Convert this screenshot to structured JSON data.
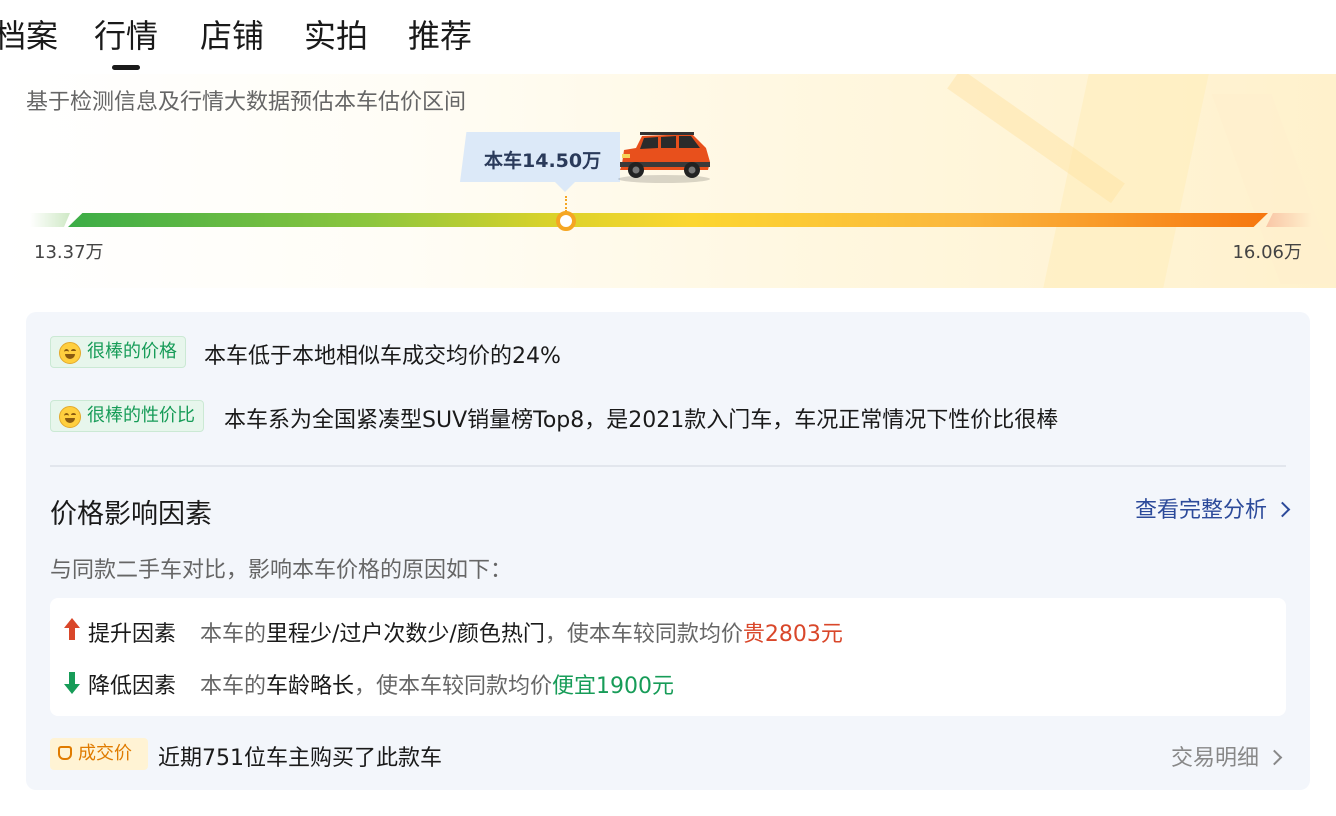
{
  "tabs": [
    {
      "label": "档案"
    },
    {
      "label": "行情",
      "active": true
    },
    {
      "label": "店铺"
    },
    {
      "label": "实拍"
    },
    {
      "label": "推荐"
    }
  ],
  "hero": {
    "subtitle": "基于检测信息及行情大数据预估本车估价区间",
    "current_price_label": "本车14.50万",
    "range_min": "13.37万",
    "range_max": "16.06万"
  },
  "ratings": [
    {
      "badge": "很棒的价格",
      "text": "本车低于本地相似车成交均价的24%"
    },
    {
      "badge": "很棒的性价比",
      "text": "本车系为全国紧凑型SUV销量榜Top8，是2021款入门车，车况正常情况下性价比很棒"
    }
  ],
  "factors": {
    "title": "价格影响因素",
    "view_link": "查看完整分析",
    "subtitle": "与同款二手车对比，影响本车价格的原因如下：",
    "up": {
      "label": "提升因素",
      "prefix": "本车的",
      "items": "里程少/过户次数少/颜色热门",
      "middle": "，使本车较同款均价",
      "result": "贵2803元"
    },
    "down": {
      "label": "降低因素",
      "prefix": "本车的",
      "items": "车龄略长",
      "middle": "，使本车较同款均价",
      "result": "便宜1900元"
    }
  },
  "deal": {
    "badge": "成交价",
    "text": "近期751位车主购买了此款车",
    "link": "交易明细"
  },
  "colors": {
    "accent_green": "#179c58",
    "accent_red": "#d9472a",
    "link_blue": "#2c4a9a",
    "marker_orange": "#f5a623"
  },
  "icons": [
    "smile-emoji-icon",
    "arrow-up-icon",
    "arrow-down-icon",
    "chevron-right-icon",
    "deal-tag-icon",
    "car-image"
  ]
}
